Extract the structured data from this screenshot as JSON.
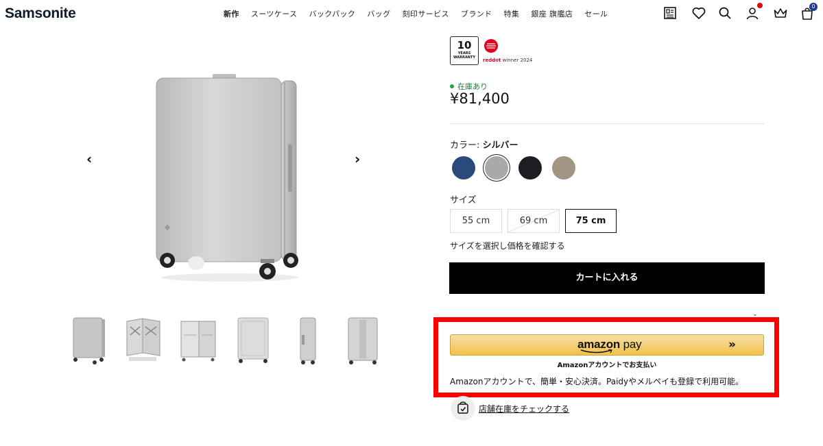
{
  "header": {
    "logo": "Samsonite",
    "nav": [
      "新作",
      "スーツケース",
      "バックパック",
      "バッグ",
      "刻印サービス",
      "ブランド",
      "特集",
      "銀座 旗艦店",
      "セール"
    ],
    "icons": [
      "catalog-icon",
      "heart-icon",
      "search-icon",
      "user-icon",
      "crown-icon",
      "cart-icon"
    ],
    "cart_count": "0"
  },
  "gallery": {
    "prev_arrow": "‹",
    "next_arrow": "›",
    "thumb_count": 6
  },
  "product": {
    "warranty_number": "10",
    "warranty_text_1": "YEARS",
    "warranty_text_2": "WARRANTY",
    "reddot_brand": "reddot",
    "reddot_rest": " winner 2024",
    "stock": "在庫あり",
    "price": "¥81,400",
    "color_label": "カラー: ",
    "color_name": "シルバー",
    "colors": [
      "#2b4a7c",
      "#a9a9a9",
      "#1e1e22",
      "#a49484"
    ],
    "selected_color_index": 1,
    "size_label": "サイズ",
    "sizes": [
      "55 cm",
      "69 cm",
      "75 cm"
    ],
    "selected_size": "75 cm",
    "size_note": "サイズを選択し価格を確認する",
    "cart_button": "カートに入れる"
  },
  "amazon": {
    "logo_amazon": "amazon",
    "logo_pay": " pay",
    "chevron": "»",
    "sub": "Amazonアカウントでお支払い",
    "desc": "Amazonアカウントで、簡単・安心決済。Paidyやメルペイも登録で利用可能。"
  },
  "store": {
    "link": "店舗在庫をチェックする"
  },
  "colors": {
    "accent_red": "#ff0000",
    "stock_green": "#1ea53f",
    "amazon_yellow": "#f0c14b",
    "cart_badge": "#1a3d8f"
  }
}
